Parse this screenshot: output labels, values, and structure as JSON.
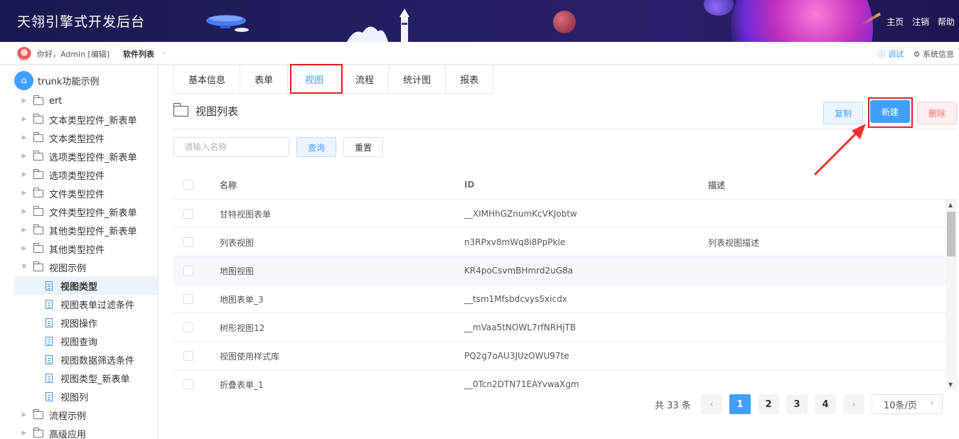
{
  "header": {
    "title": "天翎引擎式开发后台",
    "links": [
      "主页",
      "注销",
      "帮助"
    ]
  },
  "breadcrumb": {
    "greeting": "你好，Admin [编辑]",
    "current": "软件列表",
    "debug": "ⓘ 调试",
    "system_info": "⚙ 系统信息"
  },
  "sidebar": {
    "root": "trunk功能示例",
    "items": [
      {
        "label": "ert"
      },
      {
        "label": "文本类型控件_新表单"
      },
      {
        "label": "文本类型控件"
      },
      {
        "label": "选项类型控件_新表单"
      },
      {
        "label": "选项类型控件"
      },
      {
        "label": "文件类型控件"
      },
      {
        "label": "文件类型控件_新表单"
      },
      {
        "label": "其他类型控件_新表单"
      },
      {
        "label": "其他类型控件"
      },
      {
        "label": "视图示例"
      }
    ],
    "children": [
      {
        "label": "视图类型"
      },
      {
        "label": "视图表单过滤条件"
      },
      {
        "label": "视图操作"
      },
      {
        "label": "视图查询"
      },
      {
        "label": "视图数据筛选条件"
      },
      {
        "label": "视图类型_新表单"
      },
      {
        "label": "视图列"
      }
    ],
    "after": [
      {
        "label": "流程示例"
      },
      {
        "label": "高级应用"
      }
    ]
  },
  "tabs": [
    "基本信息",
    "表单",
    "视图",
    "流程",
    "统计图",
    "报表"
  ],
  "list": {
    "title": "视图列表",
    "copy": "复制",
    "new": "新建",
    "delete": "删除",
    "search_placeholder": "请输入名称",
    "query": "查询",
    "reset": "重置"
  },
  "table": {
    "columns": [
      "名称",
      "ID",
      "描述"
    ],
    "rows": [
      {
        "name": "甘特视图表单",
        "id": "__XIMHhGZnumKcVKJobtw",
        "desc": ""
      },
      {
        "name": "列表视图",
        "id": "n3RPxv8mWq8i8PpPkle",
        "desc": "列表视图描述"
      },
      {
        "name": "地图视图",
        "id": "KR4poCsvmBHmrd2uG8a",
        "desc": ""
      },
      {
        "name": "地图表单_3",
        "id": "__tsm1Mfsbdcvys5xicdx",
        "desc": ""
      },
      {
        "name": "树形视图12",
        "id": "__mVaa5tNOWL7rfNRHjTB",
        "desc": ""
      },
      {
        "name": "视图使用样式库",
        "id": "PQ2g7oAU3JUzOWU97te",
        "desc": ""
      },
      {
        "name": "折叠表单_1",
        "id": "__0Tcn2DTN71EAYvwaXgm",
        "desc": ""
      }
    ]
  },
  "pagination": {
    "total": "共 33 条",
    "pages": [
      "1",
      "2",
      "3",
      "4"
    ],
    "prev": "‹",
    "next": "›",
    "page_size": "10条/页"
  }
}
